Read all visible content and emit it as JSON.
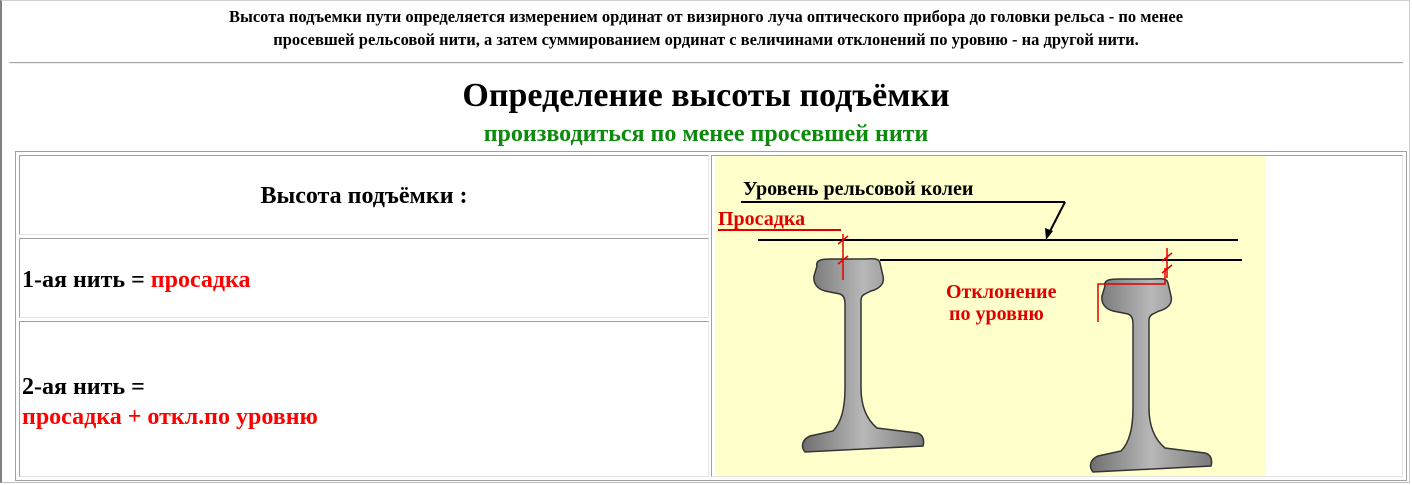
{
  "intro": {
    "line1": "Высота подъемки пути определяется измерением ординат от визирного луча оптического прибора до головки рельса - по менее",
    "line2": "просевшей рельсовой нити, а затем суммированием ординат с величинами отклонений по уровню - на другой нити."
  },
  "title": "Определение высоты подъёмки",
  "subtitle": "производиться по менее просевшей нити",
  "table": {
    "header": "Высота подъёмки :",
    "row1": {
      "prefix": "1-ая нить = ",
      "value": "просадка"
    },
    "row2": {
      "prefix": "2-ая нить =",
      "value": "просадка + откл.по уровню"
    }
  },
  "diagram": {
    "label_level": "Уровень рельсовой колеи",
    "label_sag": "Просадка",
    "label_deviation_1": "Отклонение",
    "label_deviation_2": "по   уровню"
  },
  "colors": {
    "green": "#0b8a0b",
    "red": "#ff0000",
    "diagram_background": "#ffffcc",
    "rail": "#9a9a9a"
  }
}
